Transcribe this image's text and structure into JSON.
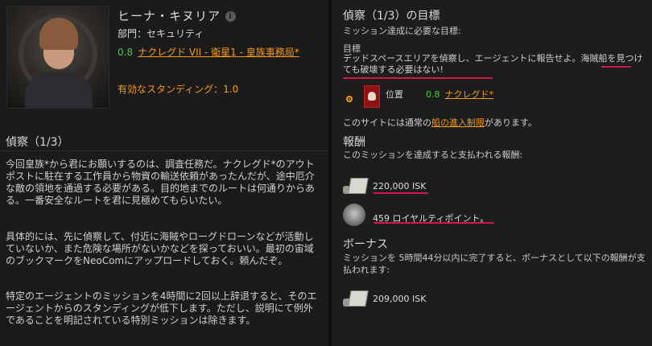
{
  "agent": {
    "name": "ヒーナ・キヌリア",
    "info_icon": "i",
    "department": "部門：セキュリティ",
    "security": "0.8",
    "location": "ナクレグド VII - 衛星1 - 皇族事務局*",
    "effective_standing": "有効なスタンディング：1.0"
  },
  "mission": {
    "title": "偵察（1/3）",
    "description": [
      "今回皇族*から君にお願いするのは、調査任務だ。ナクレグド*のアウトポストに駐在する工作員から物資の輸送依頼があったんだが、途中厄介な敵の領地を通過する必要がある。目的地までのルートは何通りからある。一番安全なルートを君に見極めてもらいたい。",
      "具体的には、先に偵察して、付近に海賊やローグドローンなどが活動していないか、また危険な場所がないかなどを探っておいい。最初の宙域のブックマークをNeoComにアップロードしておく。頼んだぞ。",
      "特定のエージェントのミッションを4時間に2回以上辞退すると、そのエージェントからのスタンディングが低下します。ただし、説明にて例外であることを明記されている特別ミッションは除きます。"
    ]
  },
  "objectives": {
    "title": "偵察（1/3）の目標",
    "subtitle": "ミッション達成に必要な目標:",
    "objective_label": "目標",
    "objective_text": "デッドスペースエリアを偵察し、エージェントに報告せよ。海賊船を見つけても破壊する必要はない!",
    "location_label": "位置",
    "location_security": "0.8",
    "location_name": "ナクレグド*",
    "site_text_before": "このサイトには通常の",
    "site_link": "船の進入制限",
    "site_text_after": "があります。"
  },
  "rewards": {
    "title": "報酬",
    "subtitle": "このミッションを達成すると支払われる報酬:",
    "isk": "220,000 ISK",
    "lp": "459 ロイヤルティポイント。"
  },
  "bonus": {
    "title": "ボーナス",
    "text": "ミッションを 5時間44分以内に完了すると、ボーナスとして以下の報酬が支払われます:",
    "isk": "209,000 ISK"
  },
  "colors": {
    "accent_orange": "#f39a1e",
    "security_green": "#3ecb3e",
    "highlight_red": "#d4194a"
  },
  "icons": [
    "info-icon",
    "location-icon",
    "isk-icon",
    "loyalty-points-icon",
    "radio-icon"
  ]
}
